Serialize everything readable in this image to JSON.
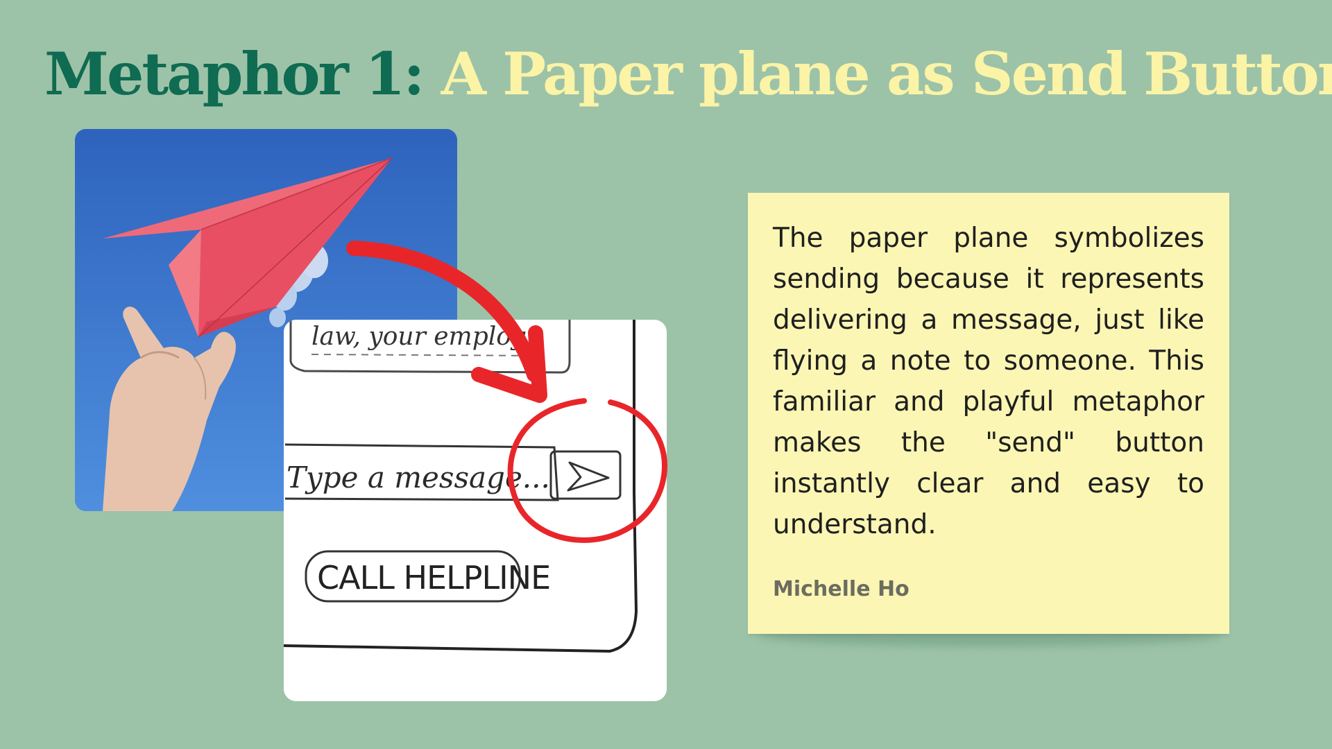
{
  "slide": {
    "title_prefix": "Metaphor 1:",
    "title_rest": "A Paper plane as Send Button",
    "colors": {
      "background": "#9cc3a8",
      "title_prefix": "#0f6b52",
      "title_rest": "#fbf3a6",
      "note_background": "#fbf6b4",
      "highlight_red": "#e8262a"
    }
  },
  "photo": {
    "icon": "paper-plane-photo"
  },
  "sketch": {
    "top_text": "law, your employ...",
    "input_placeholder": "Type a message...",
    "send_icon": "send-arrow-icon",
    "helpline_label": "CALL HELPLINE"
  },
  "note": {
    "text": "The paper plane symbolizes sending because it represents delivering a message, just like flying a note to someone. This familiar and playful metaphor makes the \"send\" button instantly clear and easy to understand.",
    "author": "Michelle Ho"
  }
}
